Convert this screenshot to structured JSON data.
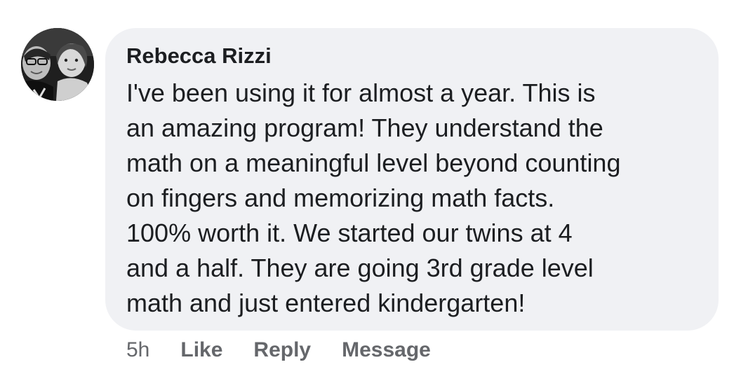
{
  "comment": {
    "author": "Rebecca Rizzi",
    "lines": [
      "I've been using it for almost a year. This is",
      "an amazing program! They understand the",
      "math on a meaningful level beyond counting",
      "on fingers and memorizing math facts.",
      "100% worth it. We started our twins at 4",
      "and a half. They are going 3rd grade level",
      "math and just entered kindergarten!"
    ],
    "bubble_color": "#f0f1f4",
    "text_color": "#1c1e21"
  },
  "actions": {
    "timestamp": "5h",
    "like_label": "Like",
    "reply_label": "Reply",
    "message_label": "Message",
    "color": "#65676b"
  }
}
